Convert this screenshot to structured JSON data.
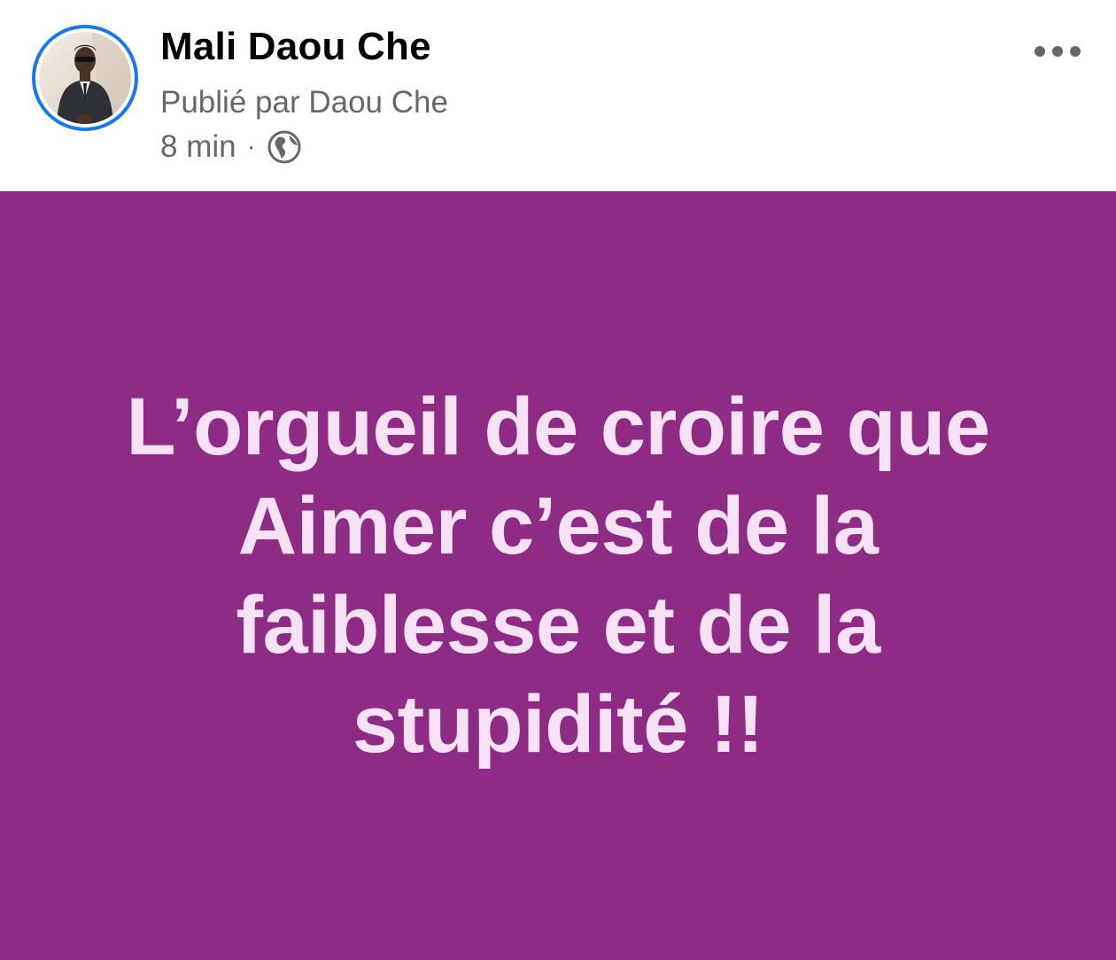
{
  "post": {
    "author_name": "Mali Daou Che",
    "published_by": "Publié par Daou Che",
    "timestamp": "8 min",
    "separator": "·",
    "audience_icon": "globe-icon",
    "more_icon": "more-options-icon",
    "text_lines": [
      "L’orgueil de croire que",
      "Aimer c’est de la",
      "faiblesse et de la",
      "stupidité !!"
    ]
  },
  "colors": {
    "avatar_ring": "#1877f2",
    "background": "#8e2b85",
    "text": "#f7e1f5",
    "secondary_text": "#65676b"
  }
}
